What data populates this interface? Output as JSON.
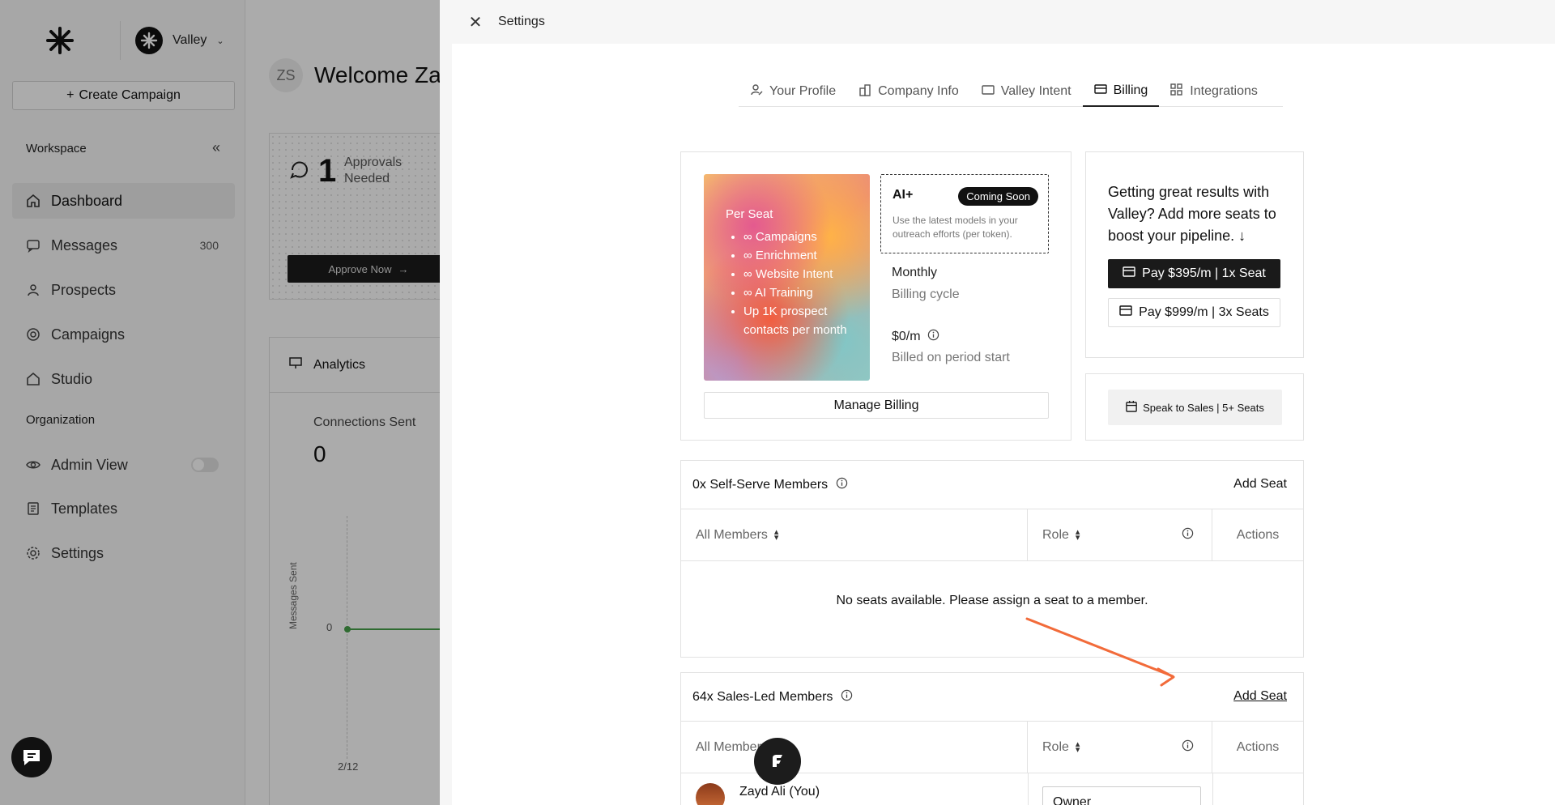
{
  "sidebar": {
    "workspace_name": "Valley",
    "create_label": "Create Campaign",
    "workspace_title": "Workspace",
    "organization_title": "Organization",
    "items": [
      {
        "label": "Dashboard",
        "icon": "home-icon"
      },
      {
        "label": "Messages",
        "icon": "message-icon",
        "count": "300"
      },
      {
        "label": "Prospects",
        "icon": "users-icon"
      },
      {
        "label": "Campaigns",
        "icon": "target-icon"
      },
      {
        "label": "Studio",
        "icon": "home-icon"
      }
    ],
    "org_items": [
      {
        "label": "Admin View",
        "icon": "eye-icon"
      },
      {
        "label": "Templates",
        "icon": "document-icon"
      },
      {
        "label": "Settings",
        "icon": "gear-icon"
      }
    ]
  },
  "dashboard": {
    "avatar_initials": "ZS",
    "welcome": "Welcome Zay",
    "approvals_count": "1",
    "approvals_label": "Approvals Needed",
    "approve_btn": "Approve Now",
    "analytics_title": "Analytics",
    "connections_label": "Connections Sent",
    "connections_value": "0",
    "y_axis_label": "Messages Sent",
    "y_tick": "0",
    "x_tick": "2/12"
  },
  "settings": {
    "title": "Settings",
    "tabs": [
      {
        "label": "Your Profile",
        "icon": "profile-icon"
      },
      {
        "label": "Company Info",
        "icon": "building-icon"
      },
      {
        "label": "Valley Intent",
        "icon": "window-icon"
      },
      {
        "label": "Billing",
        "icon": "card-icon",
        "active": true
      },
      {
        "label": "Integrations",
        "icon": "grid-icon"
      }
    ],
    "plan": {
      "name": "Per Seat",
      "features": [
        "∞ Campaigns",
        "∞ Enrichment",
        "∞ Website Intent",
        "∞ AI Training",
        "Up 1K prospect contacts per month"
      ],
      "ai_title": "AI+",
      "ai_badge": "Coming Soon",
      "ai_desc": "Use the latest models in your outreach efforts (per token).",
      "cycle_value": "Monthly",
      "cycle_label": "Billing cycle",
      "price": "$0/m",
      "billed_label": "Billed on period start",
      "manage_label": "Manage Billing"
    },
    "upsell": {
      "text": "Getting great results with Valley? Add more seats to boost your pipeline. ↓",
      "pay1": "Pay $395/m | 1x Seat",
      "pay2": "Pay $999/m | 3x Seats",
      "sales": "Speak to Sales | 5+ Seats"
    },
    "self_serve": {
      "title": "0x Self-Serve Members",
      "add_seat": "Add Seat",
      "col_members": "All Members",
      "col_role": "Role",
      "col_actions": "Actions",
      "empty": "No seats available. Please assign a seat to a member."
    },
    "sales_led": {
      "title": "64x Sales-Led Members",
      "add_seat": "Add Seat",
      "col_members": "All Members",
      "col_role": "Role",
      "col_actions": "Actions",
      "member_name": "Zayd Ali (You)",
      "member_role": "Owner"
    }
  },
  "colors": {
    "accent_dark": "#1a1a1a",
    "arrow": "#f26b3a",
    "chart_line": "#46a04a"
  }
}
